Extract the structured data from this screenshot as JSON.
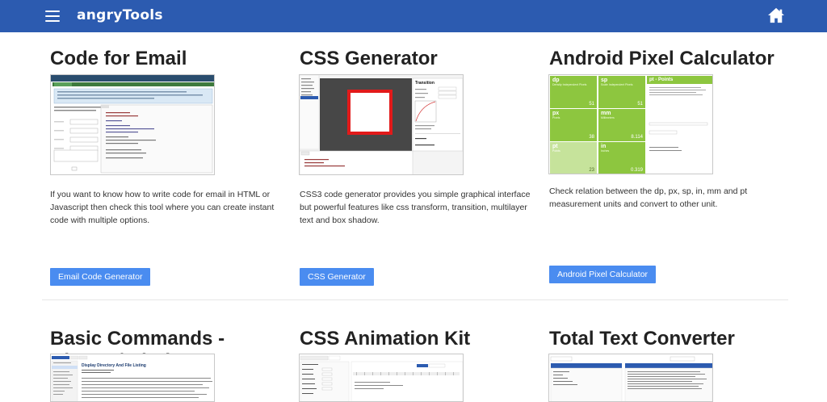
{
  "header": {
    "logo": "angryTools",
    "menu_icon": "hamburger-menu-icon",
    "home_icon": "home-icon",
    "bar_color": "#2c5bb0"
  },
  "tools": [
    {
      "title": "Code for Email",
      "description": "If you want to know how to write code for email in HTML or Javascript then check this tool where you can create instant code with multiple options.",
      "button": "Email Code Generator"
    },
    {
      "title": "CSS Generator",
      "description": "CSS3 code generator provides you simple graphical interface but powerful features like css transform, transition, multilayer text and box shadow.",
      "button": "CSS Generator"
    },
    {
      "title": "Android Pixel Calculator",
      "description": "Check relation between the dp, px, sp, in, mm and pt measurement units and convert to other unit.",
      "button": "Android Pixel Calculator",
      "preview": {
        "cells": [
          {
            "unit": "dp",
            "sub": "Density Independent Pixels",
            "value": "51"
          },
          {
            "unit": "sp",
            "sub": "Scale Independent Pixels",
            "value": "51"
          },
          {
            "unit": "px",
            "sub": "Pixels",
            "value": "38"
          },
          {
            "unit": "mm",
            "sub": "Millimeters",
            "value": "8.114"
          },
          {
            "unit": "pt",
            "sub": "Points",
            "value": "23"
          },
          {
            "unit": "in",
            "sub": "Inches",
            "value": "0.319"
          }
        ],
        "panel_title": "pt - Points"
      }
    },
    {
      "title": "Basic Commands - Ubuntu/Windows"
    },
    {
      "title": "CSS Animation Kit"
    },
    {
      "title": "Total Text Converter"
    }
  ],
  "colors": {
    "button": "#4a8cf0",
    "android_green": "#8dc63f"
  }
}
